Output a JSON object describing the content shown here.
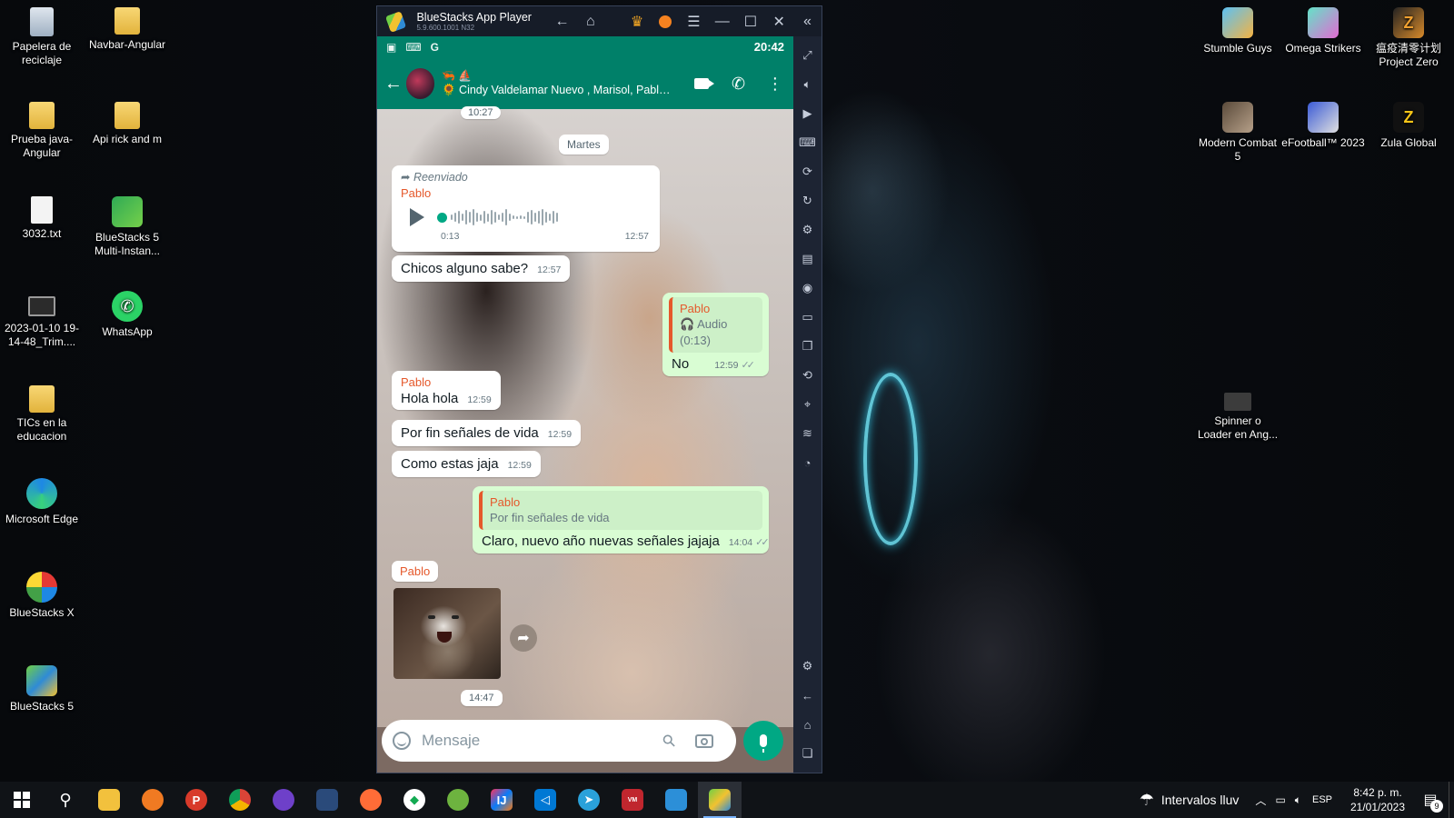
{
  "desktop": {
    "icons_left": [
      {
        "label": "Papelera de reciclaje",
        "icon": "recycle-bin-icon"
      },
      {
        "label": "Navbar-Angular",
        "icon": "folder-icon"
      },
      {
        "label": "Prueba java-Angular",
        "icon": "folder-icon"
      },
      {
        "label": "Api rick and m",
        "icon": "folder-icon"
      },
      {
        "label": "3032.txt",
        "icon": "text-file-icon"
      },
      {
        "label": "BlueStacks 5 Multi-Instan...",
        "icon": "bluestacks-multi-instance-icon"
      },
      {
        "label": "2023-01-10 19-14-48_Trim....",
        "icon": "video-file-icon"
      },
      {
        "label": "WhatsApp",
        "icon": "whatsapp-icon"
      },
      {
        "label": "TICs en la educacion",
        "icon": "folder-icon"
      },
      {
        "label": "Microsoft Edge",
        "icon": "edge-icon"
      },
      {
        "label": "BlueStacks X",
        "icon": "bluestacks-x-icon"
      },
      {
        "label": "BlueStacks 5",
        "icon": "bluestacks-5-icon"
      }
    ],
    "icons_right": [
      {
        "label": "Stumble Guys",
        "icon": "stumble-guys-icon"
      },
      {
        "label": "Omega Strikers",
        "icon": "omega-strikers-icon"
      },
      {
        "label": "瘟疫清零计划 Project Zero",
        "icon": "project-zero-icon"
      },
      {
        "label": "Modern Combat 5",
        "icon": "modern-combat-icon"
      },
      {
        "label": "eFootball™ 2023",
        "icon": "efootball-icon"
      },
      {
        "label": "Zula Global",
        "icon": "zula-icon"
      },
      {
        "label": "Spinner o Loader en Ang...",
        "icon": "spinner-file-icon"
      }
    ]
  },
  "bluestacks": {
    "title": "BlueStacks App Player",
    "version": "5.9.600.1001 N32",
    "status_time": "20:42"
  },
  "chat": {
    "group_emoji": "🦐 ⛵",
    "members": "🌻 Cindy Valdelamar Nuevo , Marisol, Pablo,...",
    "top_time": "10:27",
    "day_pill": "Martes",
    "voice": {
      "forwarded": "Reenviado",
      "sender": "Pablo",
      "duration": "0:13",
      "time": "12:57"
    },
    "messages": {
      "m1": {
        "text": "Chicos alguno sabe?",
        "time": "12:57"
      },
      "m2": {
        "quote_name": "Pablo",
        "quote_text": "🎧 Audio (0:13)",
        "text": "No",
        "time": "12:59"
      },
      "m3": {
        "sender": "Pablo",
        "text": "Hola hola",
        "time": "12:59"
      },
      "m4": {
        "text": "Por fin señales de vida",
        "time": "12:59"
      },
      "m5": {
        "text": "Como estas jaja",
        "time": "12:59"
      },
      "m6": {
        "quote_name": "Pablo",
        "quote_text": "Por fin señales de vida",
        "text": "Claro, nuevo año nuevas señales jajaja",
        "time": "14:04"
      },
      "m7": {
        "sender": "Pablo",
        "time": "14:47"
      }
    },
    "input_placeholder": "Mensaje"
  },
  "taskbar": {
    "weather": "Intervalos lluv",
    "lang": "ESP",
    "time": "8:42 p. m.",
    "date": "21/01/2023",
    "notification_count": "9"
  }
}
